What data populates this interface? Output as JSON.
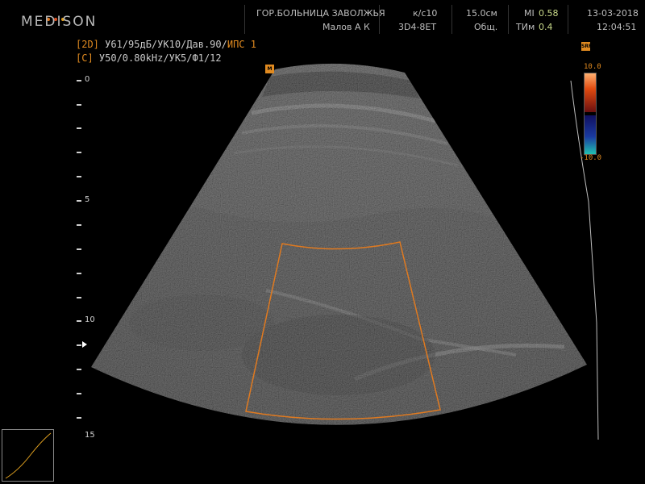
{
  "header": {
    "brand": "MEDISON",
    "brand_dot_colors": [
      "#e07820",
      "#e05020",
      "#e0a020"
    ],
    "hospital": "ГОР.БОЛЬНИЦА ЗАВОЛЖЬЯ",
    "operator": "Малов А К",
    "fps_label": "к/с10",
    "probe": "3D4-8ET",
    "depth": "15.0см",
    "preset": "Общ.",
    "mi_label": "MI",
    "mi_value": "0.58",
    "tim_label": "ТИм",
    "tim_value": "0.4",
    "date": "13-03-2018",
    "time": "12:04:51"
  },
  "params": {
    "line1_tag": "[2D]",
    "line1_text": " У61/95дБ/УК10/Дав.90/",
    "line1_highlight": "ИПС 1",
    "line2_tag": "[C]",
    "line2_text": " У50/0.80kHz/УК5/Ф1/12"
  },
  "depth_scale": {
    "labels": [
      "0",
      "5",
      "10",
      "15"
    ]
  },
  "color_bar": {
    "max": "10.0",
    "min": "-10.0",
    "badge": "SRF"
  },
  "image_marker": "M",
  "accent_color": "#e08a20",
  "background_color": "#000000"
}
